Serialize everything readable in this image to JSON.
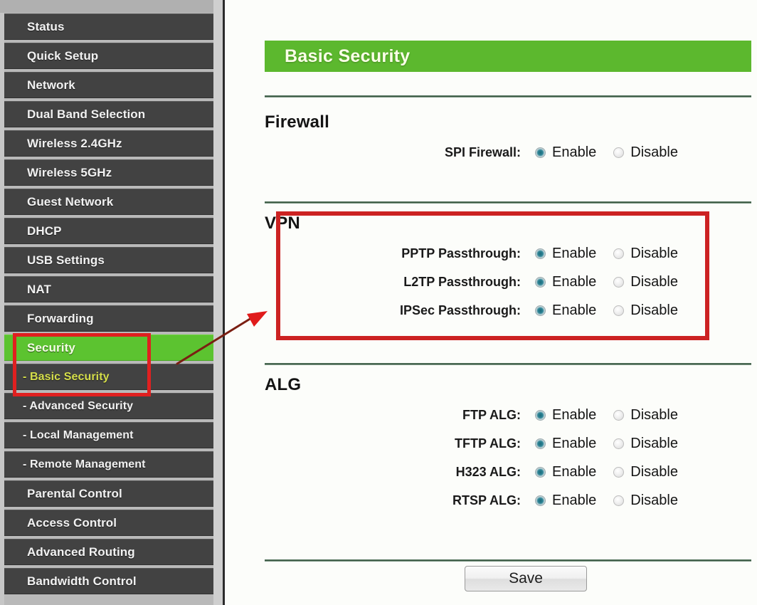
{
  "sidebar": {
    "items": [
      {
        "label": "Status",
        "type": "top",
        "state": "normal"
      },
      {
        "label": "Quick Setup",
        "type": "top",
        "state": "normal"
      },
      {
        "label": "Network",
        "type": "top",
        "state": "normal"
      },
      {
        "label": "Dual Band Selection",
        "type": "top",
        "state": "normal"
      },
      {
        "label": "Wireless 2.4GHz",
        "type": "top",
        "state": "normal"
      },
      {
        "label": "Wireless 5GHz",
        "type": "top",
        "state": "normal"
      },
      {
        "label": "Guest Network",
        "type": "top",
        "state": "normal"
      },
      {
        "label": "DHCP",
        "type": "top",
        "state": "normal"
      },
      {
        "label": "USB Settings",
        "type": "top",
        "state": "normal"
      },
      {
        "label": "NAT",
        "type": "top",
        "state": "normal"
      },
      {
        "label": "Forwarding",
        "type": "top",
        "state": "normal"
      },
      {
        "label": "Security",
        "type": "top",
        "state": "active"
      },
      {
        "label": "- Basic Security",
        "type": "sub",
        "state": "current"
      },
      {
        "label": "- Advanced Security",
        "type": "sub",
        "state": "normal"
      },
      {
        "label": "- Local Management",
        "type": "sub",
        "state": "normal"
      },
      {
        "label": "- Remote Management",
        "type": "sub",
        "state": "normal"
      },
      {
        "label": "Parental Control",
        "type": "top",
        "state": "normal"
      },
      {
        "label": "Access Control",
        "type": "top",
        "state": "normal"
      },
      {
        "label": "Advanced Routing",
        "type": "top",
        "state": "normal"
      },
      {
        "label": "Bandwidth Control",
        "type": "top",
        "state": "normal"
      }
    ]
  },
  "header": {
    "title": "Basic Security"
  },
  "sections": [
    {
      "title": "Firewall",
      "rows": [
        {
          "label": "SPI Firewall:",
          "enable_label": "Enable",
          "disable_label": "Disable",
          "selected": "enable"
        }
      ]
    },
    {
      "title": "VPN",
      "rows": [
        {
          "label": "PPTP Passthrough:",
          "enable_label": "Enable",
          "disable_label": "Disable",
          "selected": "enable"
        },
        {
          "label": "L2TP Passthrough:",
          "enable_label": "Enable",
          "disable_label": "Disable",
          "selected": "enable"
        },
        {
          "label": "IPSec Passthrough:",
          "enable_label": "Enable",
          "disable_label": "Disable",
          "selected": "enable"
        }
      ]
    },
    {
      "title": "ALG",
      "rows": [
        {
          "label": "FTP ALG:",
          "enable_label": "Enable",
          "disable_label": "Disable",
          "selected": "enable"
        },
        {
          "label": "TFTP ALG:",
          "enable_label": "Enable",
          "disable_label": "Disable",
          "selected": "enable"
        },
        {
          "label": "H323 ALG:",
          "enable_label": "Enable",
          "disable_label": "Disable",
          "selected": "enable"
        },
        {
          "label": "RTSP ALG:",
          "enable_label": "Enable",
          "disable_label": "Disable",
          "selected": "enable"
        }
      ]
    }
  ],
  "footer": {
    "save_label": "Save"
  },
  "colors": {
    "accent_green": "#5cb82e",
    "nav_active_green": "#5cc330",
    "annotation_red": "#cc2222",
    "sidebar_item": "#424242",
    "radio_selected": "#2c8496"
  }
}
